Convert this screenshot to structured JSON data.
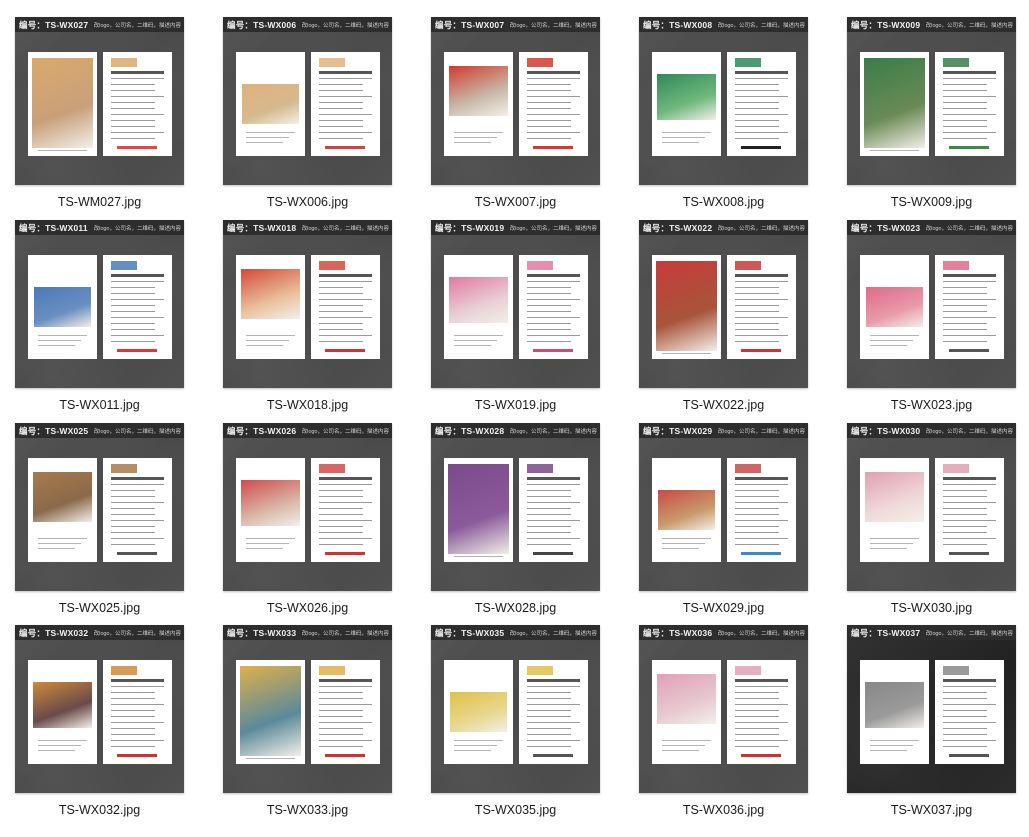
{
  "folder": {
    "header_description": "改logo，公司名，二维码，描述内容",
    "items": [
      {
        "code": "编号：TS-WX027",
        "filename": "TS-WM027.jpg",
        "accent": "#d9a96b",
        "image": "#c9a07a",
        "red": "#e04848"
      },
      {
        "code": "编号：TS-WX006",
        "filename": "TS-WX006.jpg",
        "accent": "#e0b27a",
        "image": "#d6b98f",
        "red": "#c44"
      },
      {
        "code": "编号：TS-WX007",
        "filename": "TS-WX007.jpg",
        "accent": "#d23b2e",
        "image": "#c8b9a8",
        "red": "#d23b2e"
      },
      {
        "code": "编号：TS-WX008",
        "filename": "TS-WX008.jpg",
        "accent": "#2f8a5a",
        "image": "#6fb87c",
        "red": "#222"
      },
      {
        "code": "编号：TS-WX009",
        "filename": "TS-WX009.jpg",
        "accent": "#3a7d4a",
        "image": "#6a8a55",
        "red": "#3a8a4a"
      },
      {
        "code": "编号：TS-WX011",
        "filename": "TS-WX011.jpg",
        "accent": "#4a7ab8",
        "image": "#6a8fc0",
        "red": "#d33"
      },
      {
        "code": "编号：TS-WX018",
        "filename": "TS-WX018.jpg",
        "accent": "#d24a3a",
        "image": "#e8c09a",
        "red": "#c33"
      },
      {
        "code": "编号：TS-WX019",
        "filename": "TS-WX019.jpg",
        "accent": "#e07aa0",
        "image": "#e8cfd6",
        "red": "#d24a7a"
      },
      {
        "code": "编号：TS-WX022",
        "filename": "TS-WX022.jpg",
        "accent": "#c93a3a",
        "image": "#a8553a",
        "red": "#c33"
      },
      {
        "code": "编号：TS-WX023",
        "filename": "TS-WX023.jpg",
        "accent": "#e06a8a",
        "image": "#e89aa8",
        "red": "#555"
      },
      {
        "code": "编号：TS-WX025",
        "filename": "TS-WX025.jpg",
        "accent": "#a87a4a",
        "image": "#8a6a4a",
        "red": "#555"
      },
      {
        "code": "编号：TS-WX026",
        "filename": "TS-WX026.jpg",
        "accent": "#d24a4a",
        "image": "#d8b8a8",
        "red": "#c33"
      },
      {
        "code": "编号：TS-WX028",
        "filename": "TS-WX028.jpg",
        "accent": "#7a4a8a",
        "image": "#8a5a9a",
        "red": "#444"
      },
      {
        "code": "编号：TS-WX029",
        "filename": "TS-WX029.jpg",
        "accent": "#c84a4a",
        "image": "#c89a6a",
        "red": "#3a8ac8"
      },
      {
        "code": "编号：TS-WX030",
        "filename": "TS-WX030.jpg",
        "accent": "#e0a0b0",
        "image": "#f0d8d8",
        "red": "#555"
      },
      {
        "code": "编号：TS-WX032",
        "filename": "TS-WX032.jpg",
        "accent": "#d08a3a",
        "image": "#6a4a4a",
        "red": "#c33"
      },
      {
        "code": "编号：TS-WX033",
        "filename": "TS-WX033.jpg",
        "accent": "#e0b04a",
        "image": "#5a8a9a",
        "red": "#c33"
      },
      {
        "code": "编号：TS-WX035",
        "filename": "TS-WX035.jpg",
        "accent": "#e0c04a",
        "image": "#e8d890",
        "red": "#555"
      },
      {
        "code": "编号：TS-WX036",
        "filename": "TS-WX036.jpg",
        "accent": "#e0a0b8",
        "image": "#e8c8d0",
        "red": "#c33"
      },
      {
        "code": "编号：TS-WX037",
        "filename": "TS-WX037.jpg",
        "accent": "#888888",
        "image": "#9a9a9a",
        "red": "#555",
        "dark": true
      }
    ]
  }
}
